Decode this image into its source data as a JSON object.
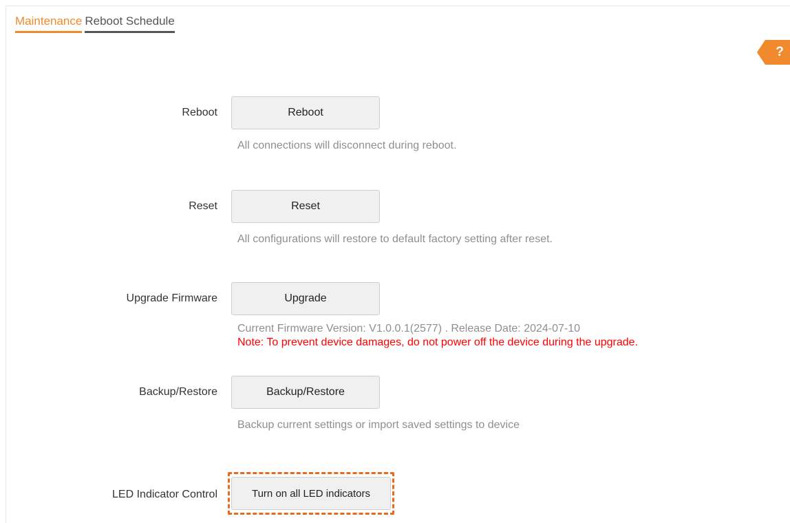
{
  "tabs": [
    {
      "label": "Maintenance",
      "active": true
    },
    {
      "label": "Reboot Schedule",
      "active": false
    }
  ],
  "help": {
    "label": "?",
    "color": "#f08a2c"
  },
  "rows": {
    "reboot": {
      "label": "Reboot",
      "button": "Reboot",
      "hint": "All connections will disconnect during reboot."
    },
    "reset": {
      "label": "Reset",
      "button": "Reset",
      "hint": "All configurations will restore to default factory setting after reset."
    },
    "upgrade": {
      "label": "Upgrade Firmware",
      "button": "Upgrade",
      "hint": "Current Firmware Version: V1.0.0.1(2577) . Release Date: 2024-07-10",
      "note": "Note: To prevent device damages, do not power off the device during the upgrade."
    },
    "backup": {
      "label": "Backup/Restore",
      "button": "Backup/Restore",
      "hint": "Backup current settings or import saved settings to device"
    },
    "led": {
      "label": "LED Indicator Control",
      "button": "Turn on all LED indicators"
    }
  },
  "colors": {
    "accent": "#f08a2c",
    "note": "#ff0000",
    "highlight": "#e96a1c"
  }
}
